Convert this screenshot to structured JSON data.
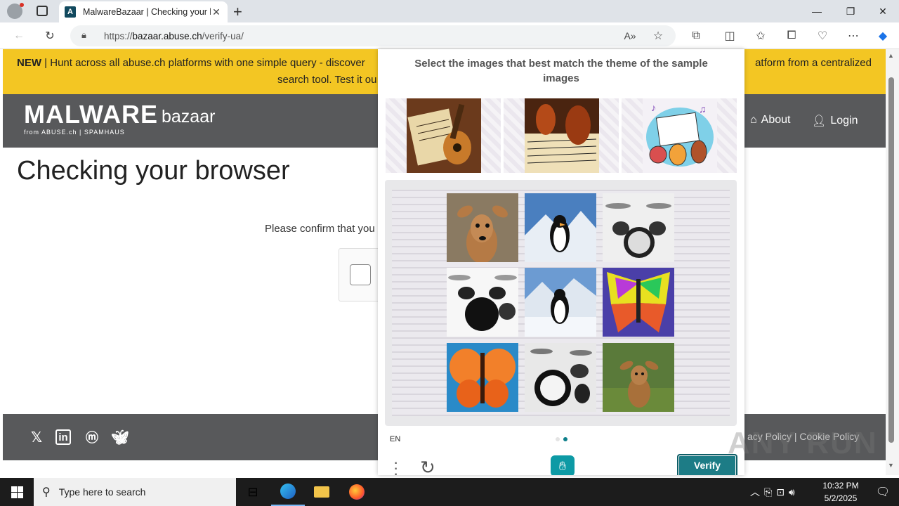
{
  "browser": {
    "tab_title": "MalwareBazaar | Checking your b",
    "tab_favicon": "A",
    "url_prefix": "https://",
    "url_domain": "bazaar.abuse.ch",
    "url_path": "/verify-ua/"
  },
  "site": {
    "banner_new": "NEW",
    "banner_text_1": " | Hunt across all abuse.ch platforms with one simple query - discover",
    "banner_text_2": "atform from a centralized",
    "banner_text_3": "search tool. Test it ou",
    "logo_main": "MALWARE",
    "logo_sub": "bazaar",
    "logo_from": "from ABUSE.ch | SPAMHAUS",
    "nav_about": "About",
    "nav_login": "Login",
    "page_title": "Checking your browser",
    "confirm_text": "Please confirm that you",
    "footer_links": "acy Policy  |  Cookie Policy"
  },
  "captcha": {
    "prompt": "Select the images that best match the theme of the sample images",
    "language": "EN",
    "verify_label": "Verify",
    "page_indicator": {
      "current": 2,
      "total": 2
    },
    "samples": [
      "guitar-and-sheet-music",
      "violin-and-sheet-music",
      "cartoon-music-instruments"
    ],
    "tiles": [
      "deer",
      "penguin",
      "drum-kit",
      "drum-kit",
      "penguin",
      "butterfly",
      "butterfly",
      "drum-kit",
      "deer"
    ]
  },
  "watermark": "ANY RUN",
  "taskbar": {
    "search_placeholder": "Type here to search",
    "time": "10:32 PM",
    "date": "5/2/2025"
  },
  "colors": {
    "banner": "#f3c623",
    "header": "#58595b",
    "verify": "#1d7c86",
    "accent": "#0d9aa5"
  }
}
